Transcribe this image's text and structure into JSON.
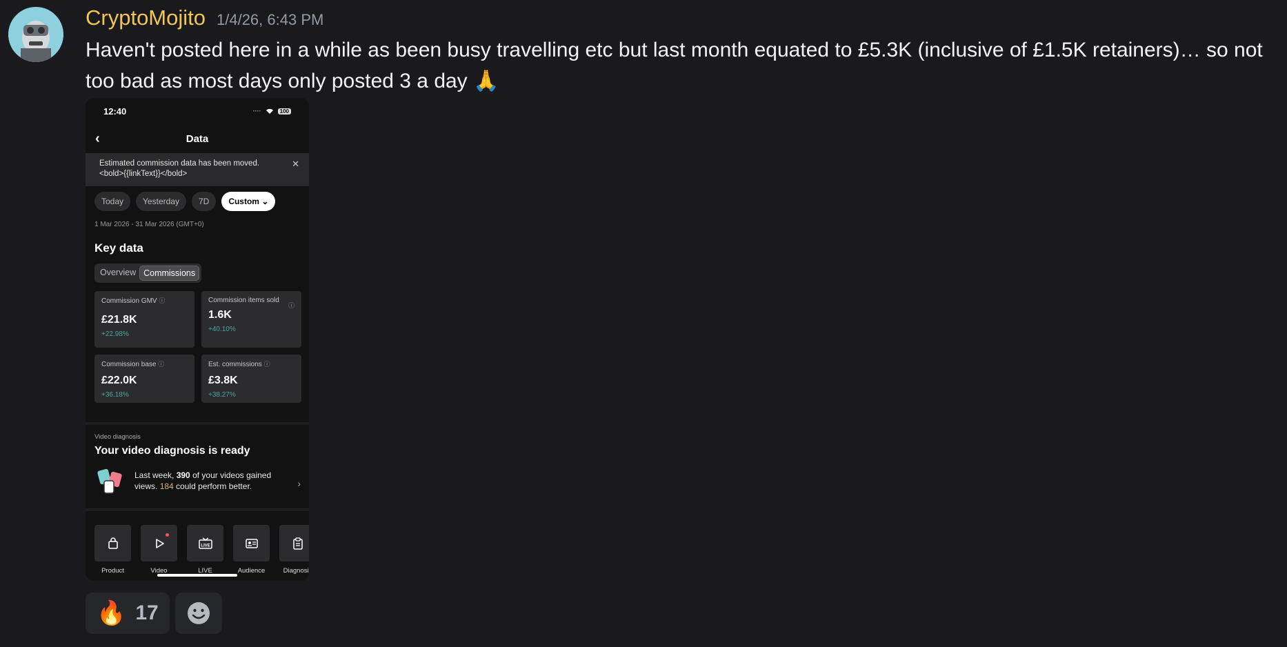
{
  "message": {
    "username": "CryptoMojito",
    "timestamp": "1/4/26, 6:43 PM",
    "text": "Haven't posted here in a while as been busy travelling etc but last month equated to £5.3K (inclusive of £1.5K retainers)… so not too bad as most days only posted 3 a day",
    "emoji": "🙏"
  },
  "phone": {
    "status_time": "12:40",
    "battery": "100",
    "nav_title": "Data",
    "banner_text": "Estimated commission data has been moved. <bold>{{linkText}}</bold>",
    "chips": [
      "Today",
      "Yesterday",
      "7D",
      "Custom"
    ],
    "active_chip": "Custom",
    "date_range": "1 Mar 2026 - 31 Mar 2026 (GMT+0)",
    "key_data_title": "Key data",
    "segments": [
      "Overview",
      "Commissions"
    ],
    "cards": [
      {
        "label": "Commission GMV",
        "value": "£21.8K",
        "delta": "+22.98%"
      },
      {
        "label": "Commission items sold",
        "value": "1.6K",
        "delta": "+40.10%"
      },
      {
        "label": "Commission base",
        "value": "£22.0K",
        "delta": "+36.18%"
      },
      {
        "label": "Est. commissions",
        "value": "£3.8K",
        "delta": "+38.27%"
      }
    ],
    "video_diagnosis": {
      "label": "Video diagnosis",
      "title": "Your video diagnosis is ready",
      "line_a": "Last week, ",
      "count_gained": "390",
      "line_b": " of your videos gained views. ",
      "count_better": "184",
      "line_c": " could perform better."
    },
    "tools": [
      "Product",
      "Video",
      "LIVE",
      "Audience",
      "Diagnosis"
    ]
  },
  "reactions": [
    {
      "emoji": "🔥",
      "count": "17",
      "icon": "fire-emoji"
    }
  ],
  "add_reaction_icon": "add-reaction-icon",
  "colors": {
    "username": "#f0c654",
    "background": "#1a1a1e",
    "delta": "#4aa7a0"
  }
}
